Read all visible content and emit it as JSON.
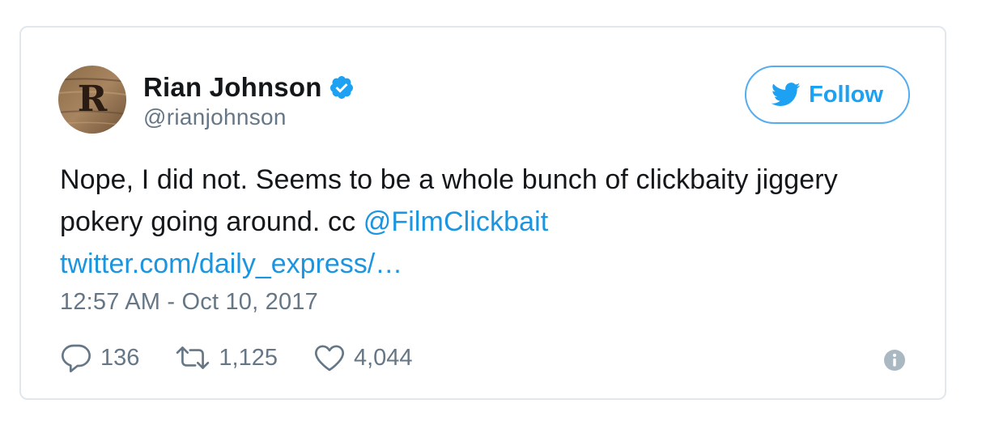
{
  "user": {
    "display_name": "Rian Johnson",
    "handle": "@rianjohnson",
    "avatar_letter": "R",
    "verified_icon": "verified-badge-icon"
  },
  "follow_button": {
    "label": "Follow",
    "icon": "twitter-bird-icon"
  },
  "tweet": {
    "text_before_mention": "Nope, I did not. Seems to be a whole bunch of clickbaity jiggery pokery going around. cc ",
    "mention": "@FilmClickbait",
    "link": "twitter.com/daily_express/…",
    "timestamp": "12:57 AM - Oct 10, 2017"
  },
  "actions": {
    "replies": "136",
    "retweets": "1,125",
    "likes": "4,044"
  },
  "colors": {
    "link": "#1b95e0",
    "text": "#14171a",
    "muted": "#657786",
    "border": "#e1e8ed",
    "brand": "#1da1f2"
  }
}
